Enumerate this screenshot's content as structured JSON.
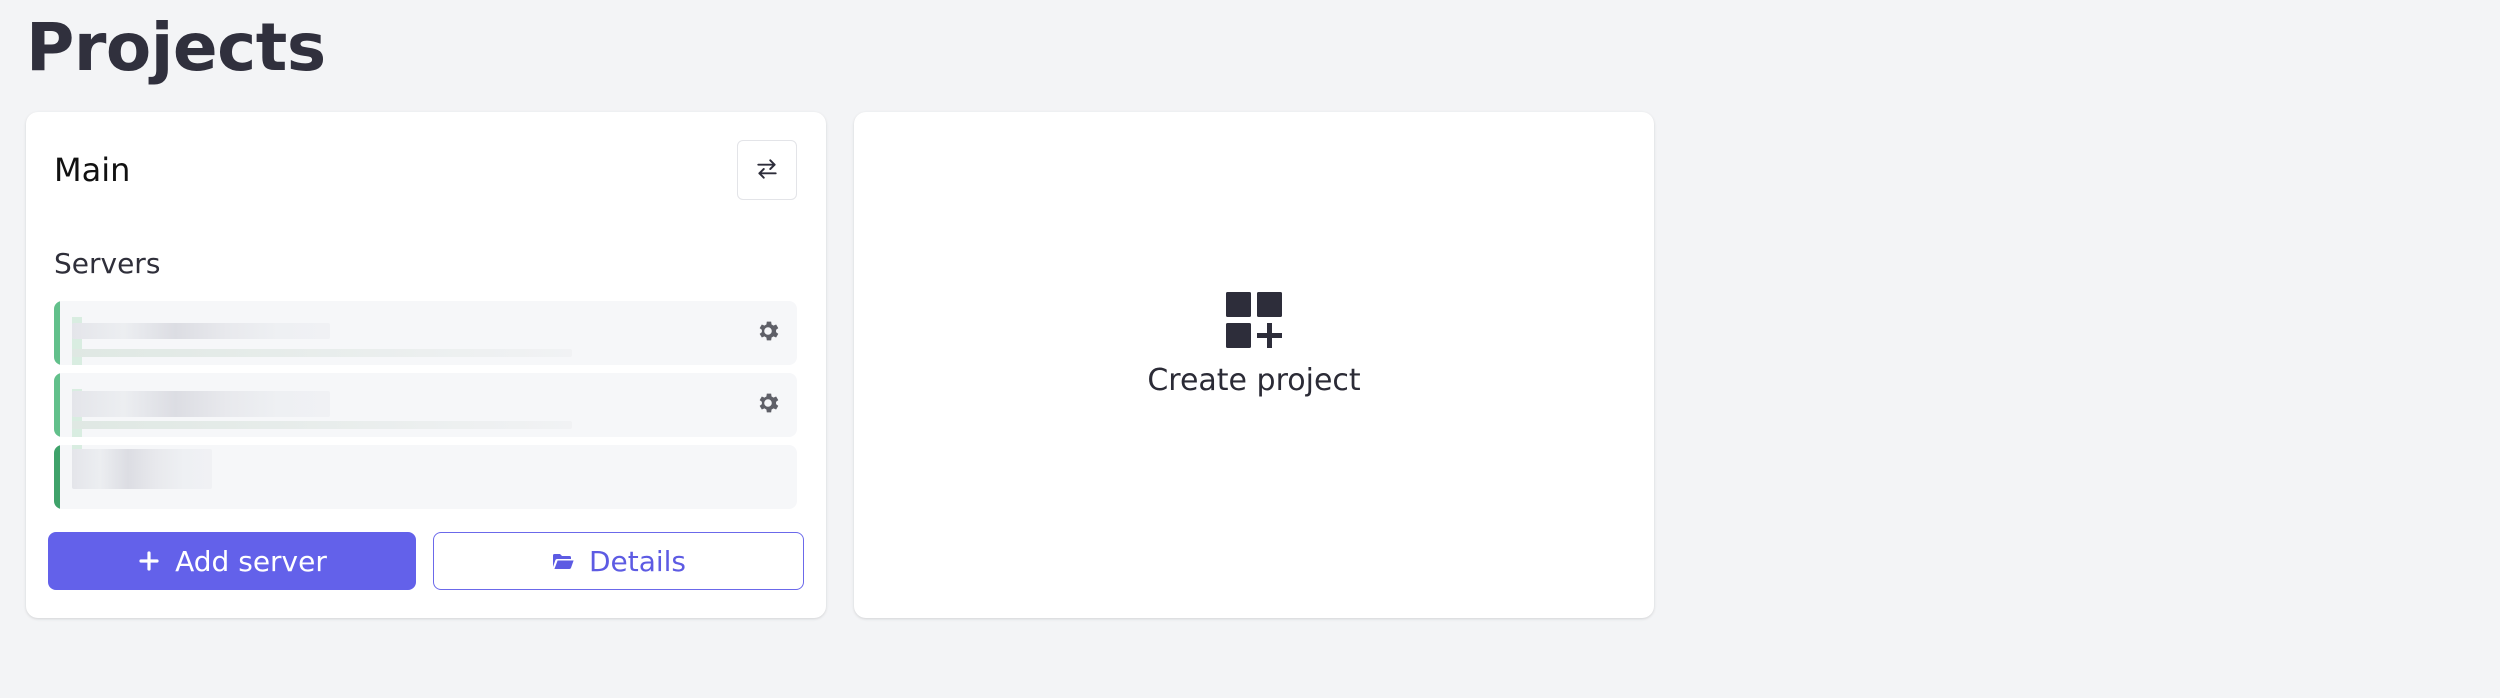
{
  "page": {
    "title": "Projects"
  },
  "project": {
    "name": "Main",
    "servers_label": "Servers",
    "servers": [
      {
        "status": "online",
        "has_settings": true
      },
      {
        "status": "online",
        "has_settings": true
      },
      {
        "status": "online",
        "has_settings": false
      }
    ],
    "add_server_label": "Add server",
    "details_label": "Details"
  },
  "create_project": {
    "label": "Create project"
  },
  "icons": {
    "switch": "arrows-swap-icon",
    "settings": "gear-icon",
    "add": "plus-icon",
    "details": "folder-open-icon",
    "create": "grid-plus-icon"
  },
  "colors": {
    "background": "#f3f4f6",
    "card": "#ffffff",
    "primary": "#6361ea",
    "status_online": "#62c08b",
    "text": "#30303d"
  }
}
